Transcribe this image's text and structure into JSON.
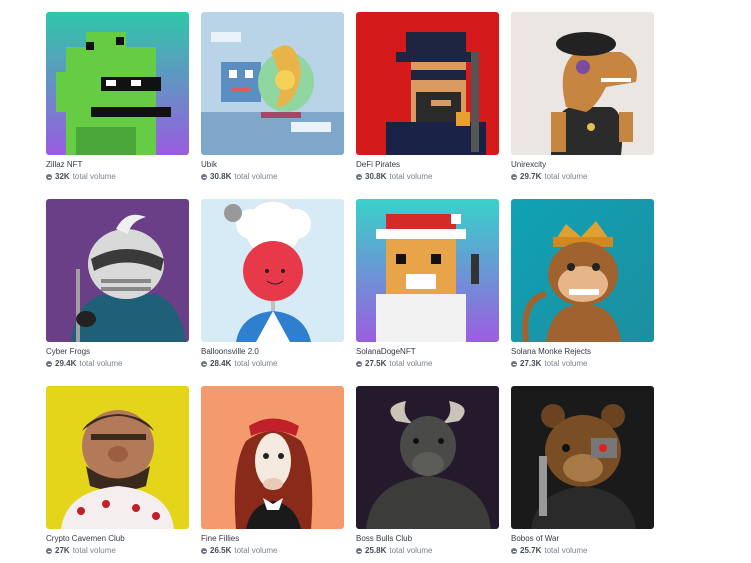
{
  "collections": [
    {
      "name": "Zillaz NFT",
      "volume": "32K",
      "volume_label": "total volume",
      "bg": "#45c59c",
      "art": "pixel-dino-icon"
    },
    {
      "name": "Ubik",
      "volume": "30.8K",
      "volume_label": "total volume",
      "bg": "#b9d6e6",
      "art": "pixel-creatures-icon"
    },
    {
      "name": "DeFi Pirates",
      "volume": "30.8K",
      "volume_label": "total volume",
      "bg": "#d71c1c",
      "art": "pixel-pirate-icon"
    },
    {
      "name": "Unirexcity",
      "volume": "29.7K",
      "volume_label": "total volume",
      "bg": "#e9e4df",
      "art": "trex-icon"
    },
    {
      "name": "Cyber Frogs",
      "volume": "29.4K",
      "volume_label": "total volume",
      "bg": "#6a3f86",
      "art": "frog-icon"
    },
    {
      "name": "Balloonsville 2.0",
      "volume": "28.4K",
      "volume_label": "total volume",
      "bg": "#d7ecf7",
      "art": "balloon-icon"
    },
    {
      "name": "SolanaDogeNFT",
      "volume": "27.5K",
      "volume_label": "total volume",
      "bg": "#3fd0cf",
      "art": "pixel-doge-icon"
    },
    {
      "name": "Solana Monke Rejects",
      "volume": "27.3K",
      "volume_label": "total volume",
      "bg": "#17a3b3",
      "art": "monkey-icon"
    },
    {
      "name": "Crypto Cavemen Club",
      "volume": "27K",
      "volume_label": "total volume",
      "bg": "#e5d51c",
      "art": "caveman-icon"
    },
    {
      "name": "Fine Fillies",
      "volume": "26.5K",
      "volume_label": "total volume",
      "bg": "#f49a6c",
      "art": "horse-icon"
    },
    {
      "name": "Boss Bulls Club",
      "volume": "25.8K",
      "volume_label": "total volume",
      "bg": "#261a2e",
      "art": "bull-icon"
    },
    {
      "name": "Bobos of War",
      "volume": "25.7K",
      "volume_label": "total volume",
      "bg": "#1b1b1b",
      "art": "bear-icon"
    }
  ]
}
